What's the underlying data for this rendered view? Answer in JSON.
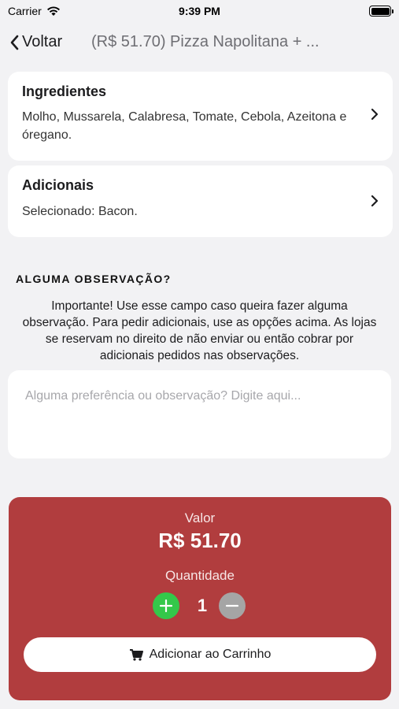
{
  "status_bar": {
    "carrier": "Carrier",
    "time": "9:39 PM"
  },
  "nav": {
    "back_label": "Voltar",
    "title": "(R$ 51.70) Pizza Napolitana + ..."
  },
  "ingredients": {
    "title": "Ingredientes",
    "text": "Molho, Mussarela, Calabresa, Tomate, Cebola, Azeitona e óregano."
  },
  "additionals": {
    "title": "Adicionais",
    "text": "Selecionado: Bacon."
  },
  "observation": {
    "heading": "ALGUMA OBSERVAÇÃO?",
    "note": "Importante! Use esse campo caso queira fazer alguma observação. Para pedir adicionais, use as opções acima. As lojas se reservam no direito de não enviar ou então cobrar por adicionais pedidos nas observações.",
    "placeholder": "Alguma preferência ou observação? Digite aqui...",
    "value": ""
  },
  "order": {
    "value_label": "Valor",
    "price": "R$ 51.70",
    "quantity_label": "Quantidade",
    "quantity": "1",
    "add_to_cart_label": "Adicionar ao Carrinho"
  },
  "colors": {
    "panel": "#b13d3e",
    "plus": "#34c84a",
    "minus": "#a5a5a5",
    "background": "#f2f2f4"
  }
}
